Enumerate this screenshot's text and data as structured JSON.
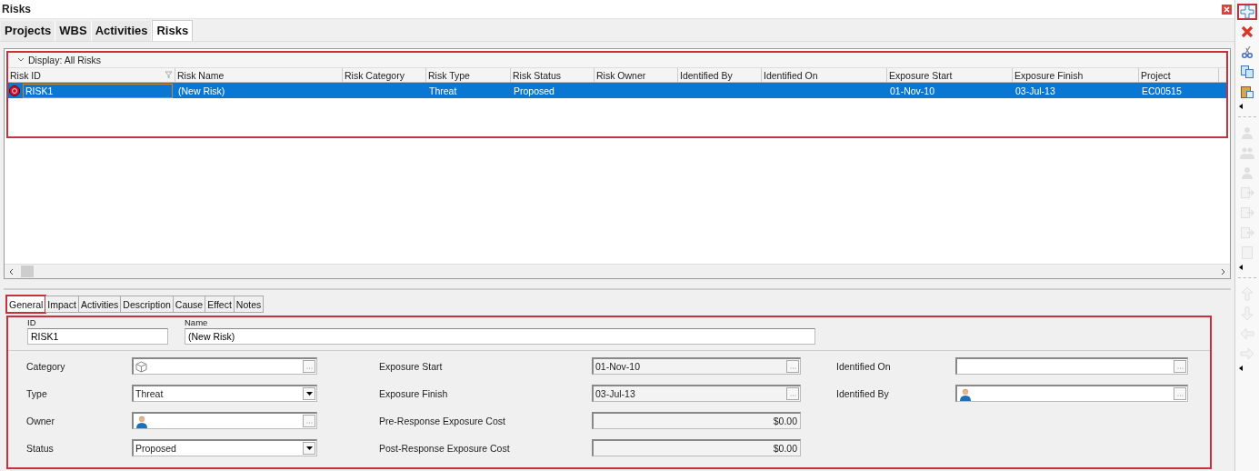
{
  "window": {
    "title": "Risks"
  },
  "tabs": [
    {
      "label": "Projects",
      "selected": false
    },
    {
      "label": "WBS",
      "selected": false
    },
    {
      "label": "Activities",
      "selected": false
    },
    {
      "label": "Risks",
      "selected": true
    }
  ],
  "grid": {
    "highlighted": true,
    "display_label": "Display: All Risks",
    "columns": [
      "Risk ID",
      "Risk Name",
      "Risk Category",
      "Risk Type",
      "Risk Status",
      "Risk Owner",
      "Identified By",
      "Identified On",
      "Exposure Start",
      "Exposure Finish",
      "Project"
    ],
    "rows": [
      {
        "selected": true,
        "cells": [
          "RISK1",
          "(New Risk)",
          "",
          "Threat",
          "Proposed",
          "",
          "",
          "",
          "01-Nov-10",
          "03-Jul-13",
          "EC00515"
        ]
      }
    ]
  },
  "detail_tabs": [
    {
      "label": "General",
      "selected": true,
      "highlighted": true
    },
    {
      "label": "Impact",
      "selected": false,
      "highlighted": false
    },
    {
      "label": "Activities",
      "selected": false,
      "highlighted": false
    },
    {
      "label": "Description",
      "selected": false,
      "highlighted": false
    },
    {
      "label": "Cause",
      "selected": false,
      "highlighted": false
    },
    {
      "label": "Effect",
      "selected": false,
      "highlighted": false
    },
    {
      "label": "Notes",
      "selected": false,
      "highlighted": false
    }
  ],
  "form": {
    "highlighted": true,
    "id": {
      "label": "ID",
      "value": "RISK1"
    },
    "name": {
      "label": "Name",
      "value": "(New Risk)"
    },
    "columns": [
      [
        {
          "label": "Category",
          "kind": "category"
        },
        {
          "label": "Type",
          "kind": "dropdown",
          "value": "Threat"
        },
        {
          "label": "Owner",
          "kind": "person"
        },
        {
          "label": "Status",
          "kind": "dropdown",
          "value": "Proposed"
        }
      ],
      [
        {
          "label": "Exposure Start",
          "kind": "date",
          "value": "01-Nov-10"
        },
        {
          "label": "Exposure Finish",
          "kind": "date",
          "value": "03-Jul-13"
        },
        {
          "label": "Pre-Response Exposure Cost",
          "kind": "amount",
          "value": "$0.00"
        },
        {
          "label": "Post-Response Exposure Cost",
          "kind": "amount",
          "value": "$0.00"
        }
      ],
      [
        {
          "label": "Identified On",
          "kind": "browse"
        },
        {
          "label": "Identified By",
          "kind": "person"
        }
      ]
    ]
  },
  "toolbar": [
    [
      {
        "kind": "add",
        "disabled": false,
        "highlighted": true
      },
      {
        "kind": "delete",
        "disabled": false,
        "highlighted": false
      },
      {
        "kind": "cut",
        "disabled": false,
        "highlighted": false
      },
      {
        "kind": "copy",
        "disabled": false,
        "highlighted": false
      },
      {
        "kind": "paste",
        "disabled": false,
        "highlighted": false
      }
    ],
    [
      {
        "kind": "person",
        "disabled": true,
        "highlighted": false
      },
      {
        "kind": "people",
        "disabled": true,
        "highlighted": false
      },
      {
        "kind": "person",
        "disabled": true,
        "highlighted": false
      },
      {
        "kind": "page-arrow",
        "disabled": true,
        "highlighted": false
      },
      {
        "kind": "page-arrow",
        "disabled": true,
        "highlighted": false
      },
      {
        "kind": "page-arrow",
        "disabled": true,
        "highlighted": false
      },
      {
        "kind": "page",
        "disabled": true,
        "highlighted": false
      }
    ],
    [
      {
        "kind": "up",
        "disabled": true,
        "highlighted": false
      },
      {
        "kind": "down",
        "disabled": true,
        "highlighted": false
      },
      {
        "kind": "left",
        "disabled": true,
        "highlighted": false
      },
      {
        "kind": "right",
        "disabled": true,
        "highlighted": false
      }
    ]
  ]
}
